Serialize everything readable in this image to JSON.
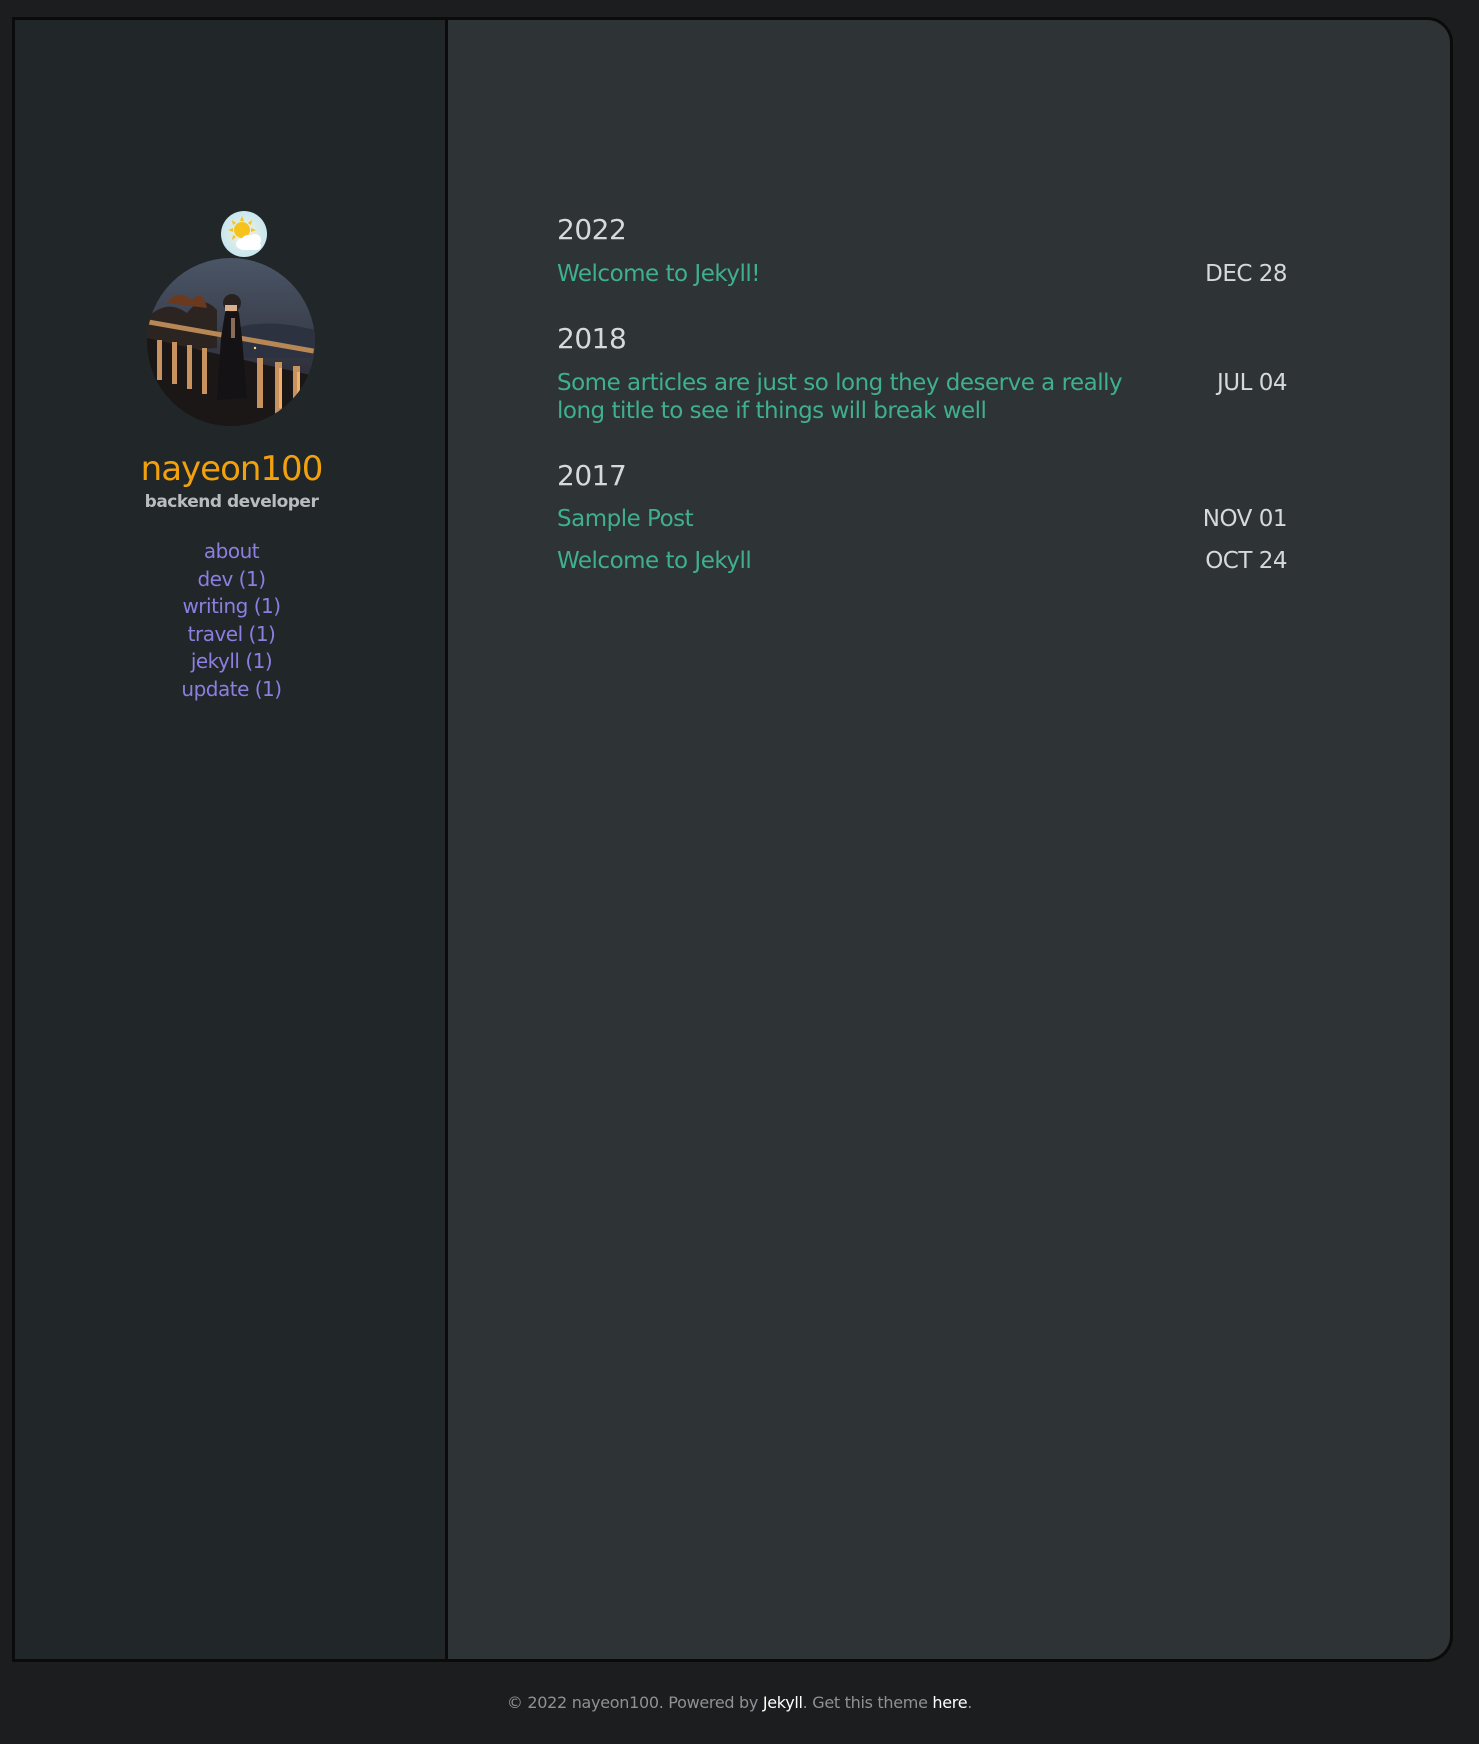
{
  "sidebar": {
    "weather_icon": "sun-behind-cloud-icon",
    "avatar": "profile-photo",
    "title": "nayeon100",
    "subtitle": "backend developer",
    "nav": [
      {
        "label": "about"
      },
      {
        "label": "dev (1)"
      },
      {
        "label": "writing (1)"
      },
      {
        "label": "travel (1)"
      },
      {
        "label": "jekyll (1)"
      },
      {
        "label": "update (1)"
      }
    ]
  },
  "archive": [
    {
      "year": "2022",
      "posts": [
        {
          "title": "Welcome to Jekyll!",
          "date": "DEC 28"
        }
      ]
    },
    {
      "year": "2018",
      "posts": [
        {
          "title": "Some articles are just so long they deserve a really long title to see if things will break well",
          "date": "JUL 04"
        }
      ]
    },
    {
      "year": "2017",
      "posts": [
        {
          "title": "Sample Post",
          "date": "NOV 01"
        },
        {
          "title": "Welcome to Jekyll",
          "date": "OCT 24"
        }
      ]
    }
  ],
  "footer": {
    "prefix": "© 2022 nayeon100. Powered by ",
    "jekyll_link": "Jekyll",
    "middle": ". Get this theme ",
    "here_link": "here",
    "suffix": "."
  },
  "colors": {
    "accent_title": "#f1a10e",
    "nav_link": "#8b7fe0",
    "post_link": "#3fb08c",
    "background": "#2e3336",
    "sidebar_background": "#212629"
  }
}
